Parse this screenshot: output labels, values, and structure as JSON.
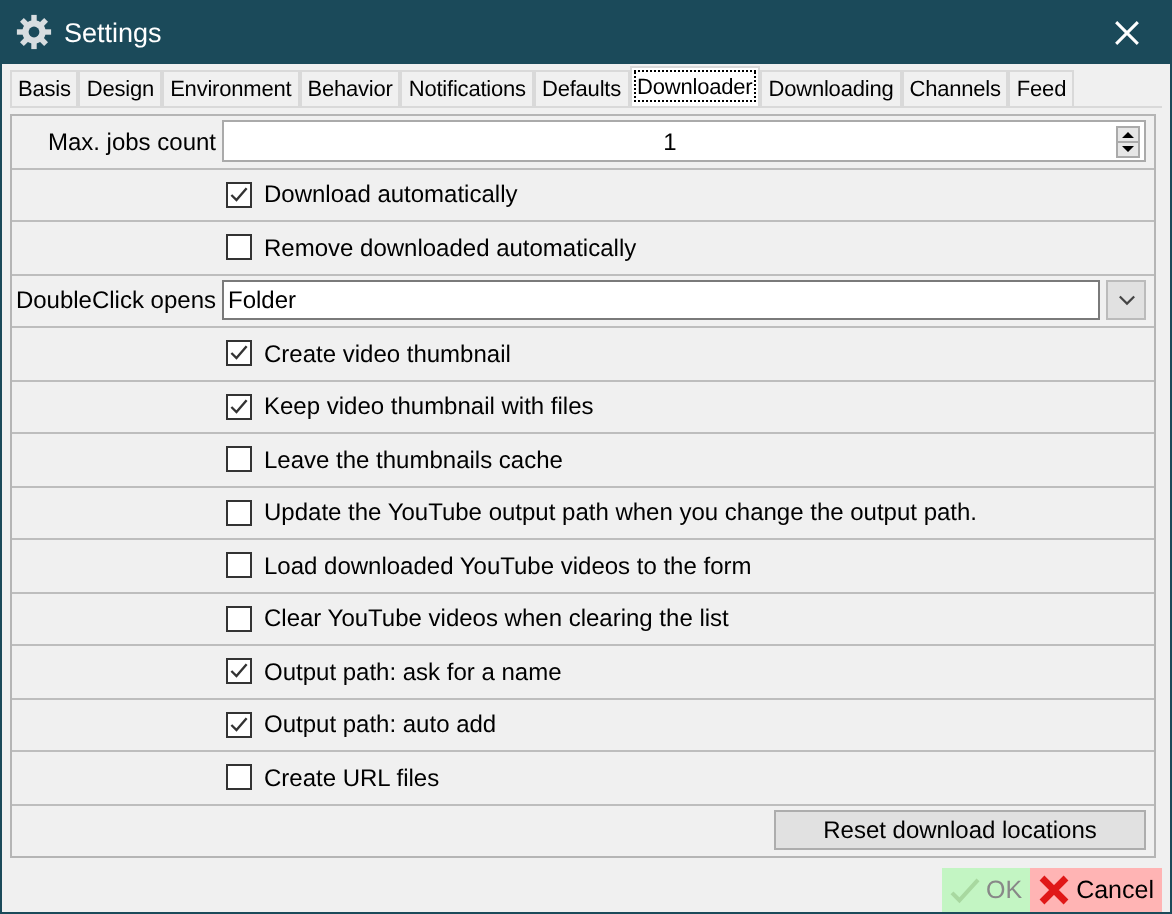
{
  "window": {
    "title": "Settings"
  },
  "tabs": [
    {
      "label": "Basis",
      "selected": false
    },
    {
      "label": "Design",
      "selected": false
    },
    {
      "label": "Environment",
      "selected": false
    },
    {
      "label": "Behavior",
      "selected": false
    },
    {
      "label": "Notifications",
      "selected": false
    },
    {
      "label": "Defaults",
      "selected": false
    },
    {
      "label": "Downloader",
      "selected": true
    },
    {
      "label": "Downloading",
      "selected": false
    },
    {
      "label": "Channels",
      "selected": false
    },
    {
      "label": "Feed",
      "selected": false
    }
  ],
  "rows": [
    {
      "kind": "number",
      "label": "Max. jobs count",
      "value": "1"
    },
    {
      "kind": "checkbox",
      "label": "Download automatically",
      "checked": true
    },
    {
      "kind": "checkbox",
      "label": "Remove downloaded automatically",
      "checked": false
    },
    {
      "kind": "combo",
      "label": "DoubleClick opens",
      "value": "Folder"
    },
    {
      "kind": "checkbox",
      "label": "Create video thumbnail",
      "checked": true
    },
    {
      "kind": "checkbox",
      "label": "Keep video thumbnail with files",
      "checked": true
    },
    {
      "kind": "checkbox",
      "label": "Leave the thumbnails cache",
      "checked": false
    },
    {
      "kind": "checkbox",
      "label": "Update the YouTube output path when you change the output path.",
      "checked": false
    },
    {
      "kind": "checkbox",
      "label": "Load downloaded YouTube videos to the form",
      "checked": false
    },
    {
      "kind": "checkbox",
      "label": "Clear YouTube videos when clearing the list",
      "checked": false
    },
    {
      "kind": "checkbox",
      "label": "Output path: ask for a name",
      "checked": true
    },
    {
      "kind": "checkbox",
      "label": "Output path: auto add",
      "checked": true
    },
    {
      "kind": "checkbox",
      "label": "Create URL files",
      "checked": false
    },
    {
      "kind": "button",
      "label": "Reset download locations"
    }
  ],
  "buttons": [
    {
      "kind": "ok",
      "label": "OK"
    },
    {
      "kind": "cancel",
      "label": "Cancel"
    }
  ]
}
